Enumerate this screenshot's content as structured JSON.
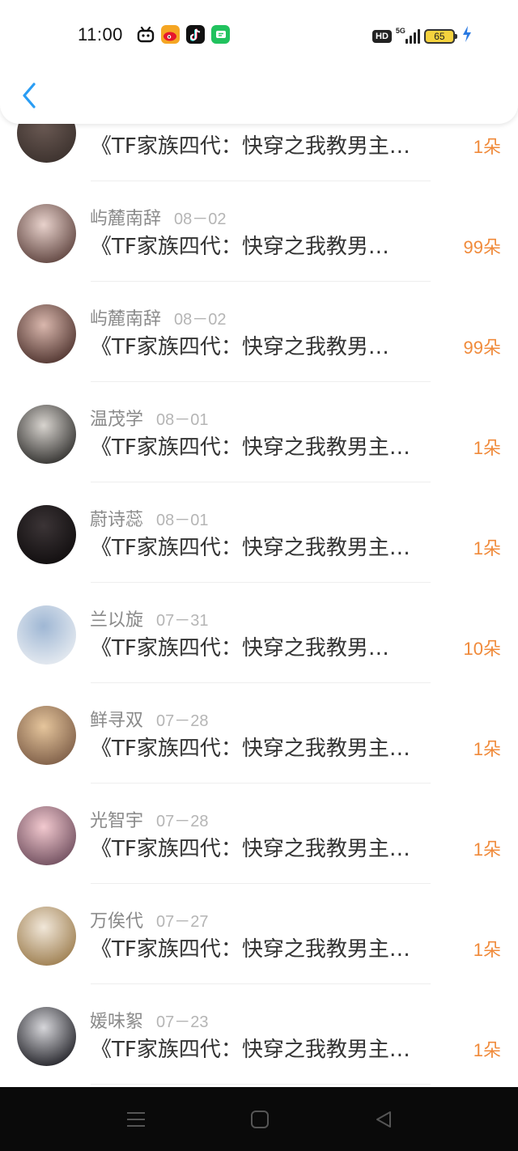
{
  "status_bar": {
    "time": "11:00",
    "icons": [
      "bilibili-icon",
      "weibo-icon",
      "tiktok-icon",
      "messages-icon"
    ],
    "hd_badge": "HD",
    "network": "5G",
    "battery": "65",
    "charging": true
  },
  "header": {
    "back_icon": "chevron-left-icon",
    "accent": "#2a9df4"
  },
  "list": {
    "items": [
      {
        "name": "",
        "date": "",
        "book": "《TF家族四代：快穿之我教男主…",
        "flowers": "1朵",
        "avatar_colors": [
          "#6b5a54",
          "#3a302c"
        ]
      },
      {
        "name": "屿麓南辞",
        "date": "08－02",
        "book": "《TF家族四代：快穿之我教男…",
        "flowers": "99朵",
        "avatar_colors": [
          "#e8d2cc",
          "#5a3f3a"
        ]
      },
      {
        "name": "屿麓南辞",
        "date": "08－02",
        "book": "《TF家族四代：快穿之我教男…",
        "flowers": "99朵",
        "avatar_colors": [
          "#d9b7ad",
          "#4a2f2a"
        ]
      },
      {
        "name": "温茂学",
        "date": "08－01",
        "book": "《TF家族四代：快穿之我教男主…",
        "flowers": "1朵",
        "avatar_colors": [
          "#d8d4cf",
          "#2b2a28"
        ]
      },
      {
        "name": "蔚诗蕊",
        "date": "08－01",
        "book": "《TF家族四代：快穿之我教男主…",
        "flowers": "1朵",
        "avatar_colors": [
          "#3b3436",
          "#0f0c0d"
        ]
      },
      {
        "name": "兰以旋",
        "date": "07－31",
        "book": "《TF家族四代：快穿之我教男…",
        "flowers": "10朵",
        "avatar_colors": [
          "#9fb7d4",
          "#e9edf2"
        ]
      },
      {
        "name": "鲜寻双",
        "date": "07－28",
        "book": "《TF家族四代：快穿之我教男主…",
        "flowers": "1朵",
        "avatar_colors": [
          "#e5c59c",
          "#7a5a44"
        ]
      },
      {
        "name": "光智宇",
        "date": "07－28",
        "book": "《TF家族四代：快穿之我教男主…",
        "flowers": "1朵",
        "avatar_colors": [
          "#f2c9cf",
          "#6b4a5a"
        ]
      },
      {
        "name": "万俟代",
        "date": "07－27",
        "book": "《TF家族四代：快穿之我教男主…",
        "flowers": "1朵",
        "avatar_colors": [
          "#f1e7d9",
          "#9a7a4a"
        ]
      },
      {
        "name": "媛味絮",
        "date": "07－23",
        "book": "《TF家族四代：快穿之我教男主…",
        "flowers": "1朵",
        "avatar_colors": [
          "#d6d6da",
          "#1c1c22"
        ]
      }
    ]
  },
  "navbar": {
    "buttons": [
      "menu-icon",
      "home-icon",
      "back-triangle-icon"
    ]
  },
  "colors": {
    "flower_text": "#f08a3a",
    "name_text": "#8a8a8a",
    "date_text": "#b5b5b5",
    "book_text": "#333333"
  }
}
